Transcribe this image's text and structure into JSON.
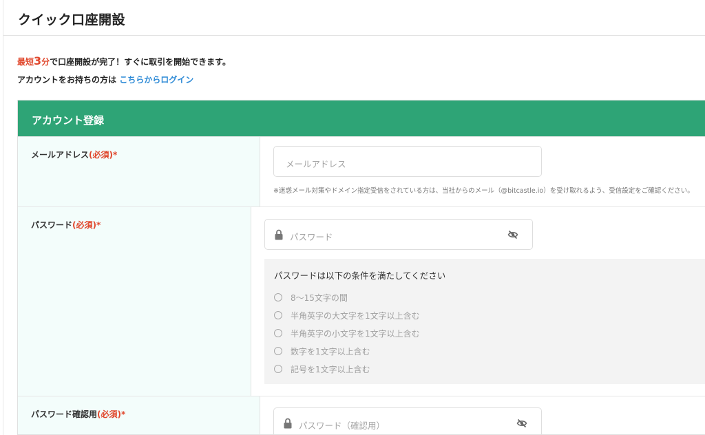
{
  "header": {
    "title": "クイック口座開設"
  },
  "intro": {
    "prefix": "最短",
    "number": "3",
    "unit": "分",
    "rest": "で口座開設が完了！すぐに取引を開始できます。",
    "login_prompt": "アカウントをお持ちの方は",
    "login_link": "こちらからログイン"
  },
  "form": {
    "section_title": "アカウント登録",
    "email": {
      "label": "メールアドレス",
      "required": "(必須)*",
      "placeholder": "メールアドレス",
      "note": "※迷惑メール対策やドメイン指定受信をされている方は、当社からのメール（@bitcastle.io）を受け取れるよう、受信設定をご確認ください。"
    },
    "password": {
      "label": "パスワード",
      "required": "(必須)*",
      "placeholder": "パスワード",
      "conditions_title": "パスワードは以下の条件を満たしてください",
      "conditions": [
        "8〜15文字の間",
        "半角英字の大文字を1文字以上含む",
        "半角英字の小文字を1文字以上含む",
        "数字を1文字以上含む",
        "記号を1文字以上含む"
      ]
    },
    "password_confirm": {
      "label": "パスワード確認用",
      "required": "(必須)*",
      "placeholder": "パスワード（確認用）"
    }
  },
  "icons": {
    "lock": "lock-icon",
    "visibility": "eye-off-icon"
  },
  "colors": {
    "accent": "#2ea476",
    "required": "#e0472c",
    "link": "#2d8ad6"
  }
}
